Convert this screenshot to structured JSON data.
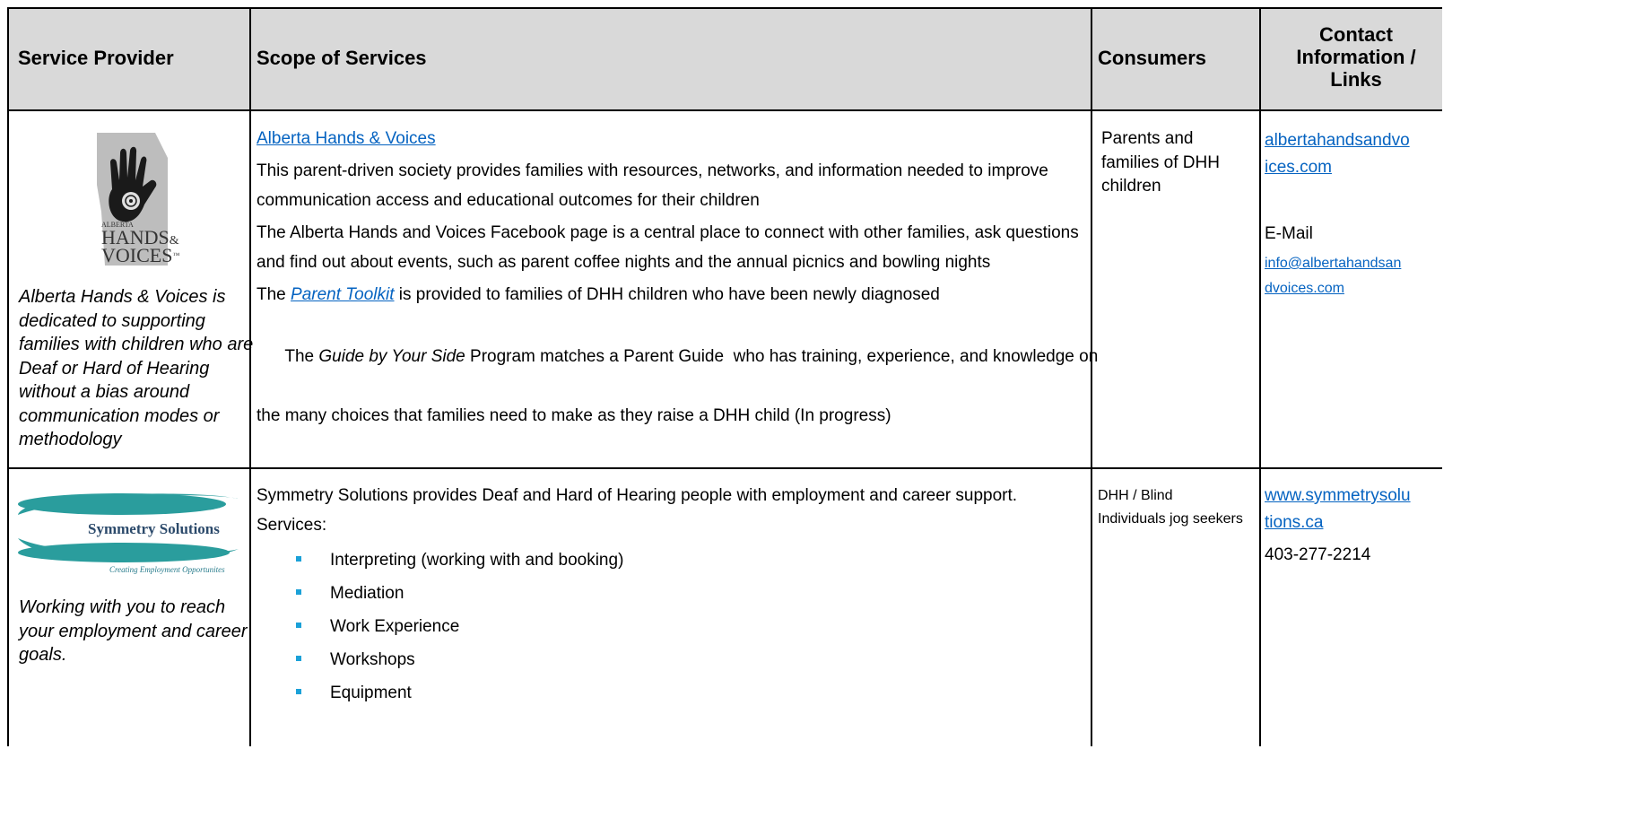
{
  "headers": {
    "provider": "Service Provider",
    "scope": "Scope of Services",
    "consumers": "Consumers",
    "contact_line1": "Contact",
    "contact_line2": "Information /",
    "contact_line3": "Links"
  },
  "row1": {
    "logo": {
      "small_text": "ALBERTA",
      "big_text1": "HANDS",
      "amp": "&",
      "big_text2": "VOICES",
      "tm": "™"
    },
    "provider_description_lines": [
      "Alberta Hands & Voices is",
      "dedicated to supporting",
      "families with children who are",
      "Deaf or Hard of Hearing",
      "without a bias around",
      "communication modes or",
      "methodology"
    ],
    "scope_title_link": "Alberta Hands & Voices",
    "scope_p1_line1": "This parent-driven society provides families with resources, networks, and information needed to improve",
    "scope_p1_line2": "communication access and educational outcomes for their children",
    "scope_p2_line1": "The Alberta Hands and Voices Facebook page is a central place to connect with other families, ask questions",
    "scope_p2_line2": "and find out about events, such as parent coffee nights and the annual picnics and bowling nights",
    "scope_p3_prefix": "The ",
    "scope_p3_link": "Parent Toolkit",
    "scope_p3_suffix": " is provided to families of DHH children who have been newly diagnosed",
    "scope_p4_prefix": "The ",
    "scope_p4_italic": "Guide by Your Side",
    "scope_p4_rest": " Program matches a Parent Guide  who has training, experience, and knowledge on",
    "scope_p4_line2": "the many choices that families need to make as they raise a DHH child (In progress)",
    "consumers_lines": [
      "Parents and",
      "families of DHH",
      "children"
    ],
    "contact_link1_line1": "albertahandsandvo",
    "contact_link1_line2": "ices.com",
    "contact_email_label": "E-Mail",
    "contact_email_line1": "info@albertahandsan",
    "contact_email_line2": "dvoices.com"
  },
  "row2": {
    "logo": {
      "name": "Symmetry Solutions",
      "tagline": "Creating Employment Opportunites",
      "accent_color": "#2a9d9d"
    },
    "provider_description_lines": [
      "Working with you to reach",
      "your employment and career",
      "goals."
    ],
    "scope_line1": "Symmetry Solutions provides Deaf and Hard of Hearing people with employment and career support.",
    "scope_line2": "Services:",
    "services": [
      "Interpreting (working with and booking)",
      "Mediation",
      "Work Experience",
      "Workshops",
      "Equipment"
    ],
    "consumers_line1": "DHH / Blind",
    "consumers_line2": "Individuals jog seekers",
    "contact_link_line1": "www.symmetrysolu",
    "contact_link_line2": "tions.ca",
    "contact_phone": "403-277-2214"
  },
  "colors": {
    "header_bg": "#d9d9d9",
    "link": "#0563c1",
    "bullet": "#1ba1d8"
  }
}
